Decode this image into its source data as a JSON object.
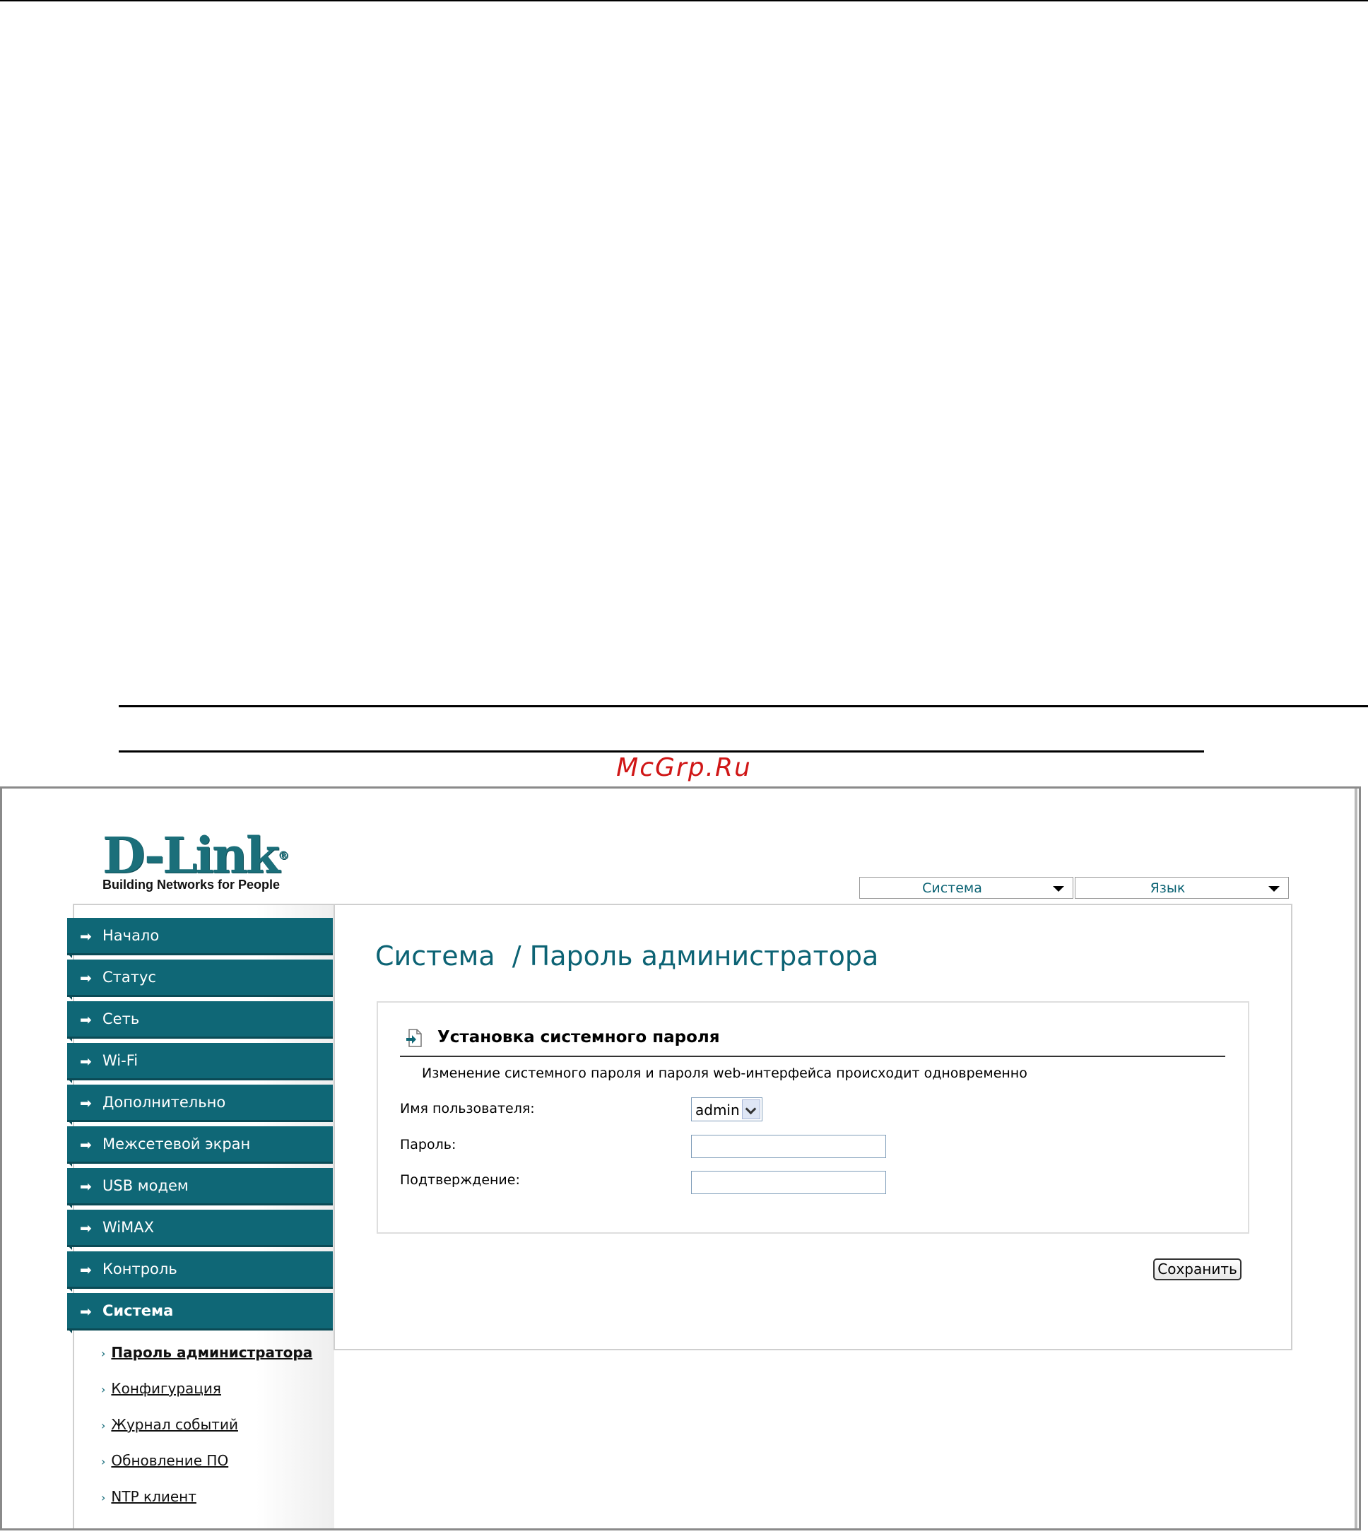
{
  "watermark": "McGrp.Ru",
  "logo": {
    "brand": "D-Link",
    "tagline": "Building Networks for People"
  },
  "top_menu": [
    {
      "label": "Система"
    },
    {
      "label": "Язык"
    }
  ],
  "nav": [
    {
      "label": "Начало"
    },
    {
      "label": "Статус"
    },
    {
      "label": "Сеть"
    },
    {
      "label": "Wi-Fi"
    },
    {
      "label": "Дополнительно"
    },
    {
      "label": "Межсетевой экран"
    },
    {
      "label": "USB модем"
    },
    {
      "label": "WiMAX"
    },
    {
      "label": "Контроль"
    },
    {
      "label": "Система"
    }
  ],
  "subnav": [
    {
      "label": "Пароль администратора"
    },
    {
      "label": "Конфигурация"
    },
    {
      "label": "Журнал событий"
    },
    {
      "label": "Обновление ПО"
    },
    {
      "label": "NTP клиент"
    }
  ],
  "page_title": "Система  / Пароль администратора",
  "section": {
    "title": "Установка системного пароля",
    "description": "Изменение системного пароля и пароля web-интерфейса происходит одновременно",
    "username_label": "Имя пользователя:",
    "username_value": "admin",
    "password_label": "Пароль:",
    "password_value": "",
    "confirm_label": "Подтверждение:",
    "confirm_value": ""
  },
  "save_label": "Сохранить",
  "colors": {
    "accent": "#0f6776",
    "title": "#0c6374",
    "watermark": "#d01616"
  }
}
